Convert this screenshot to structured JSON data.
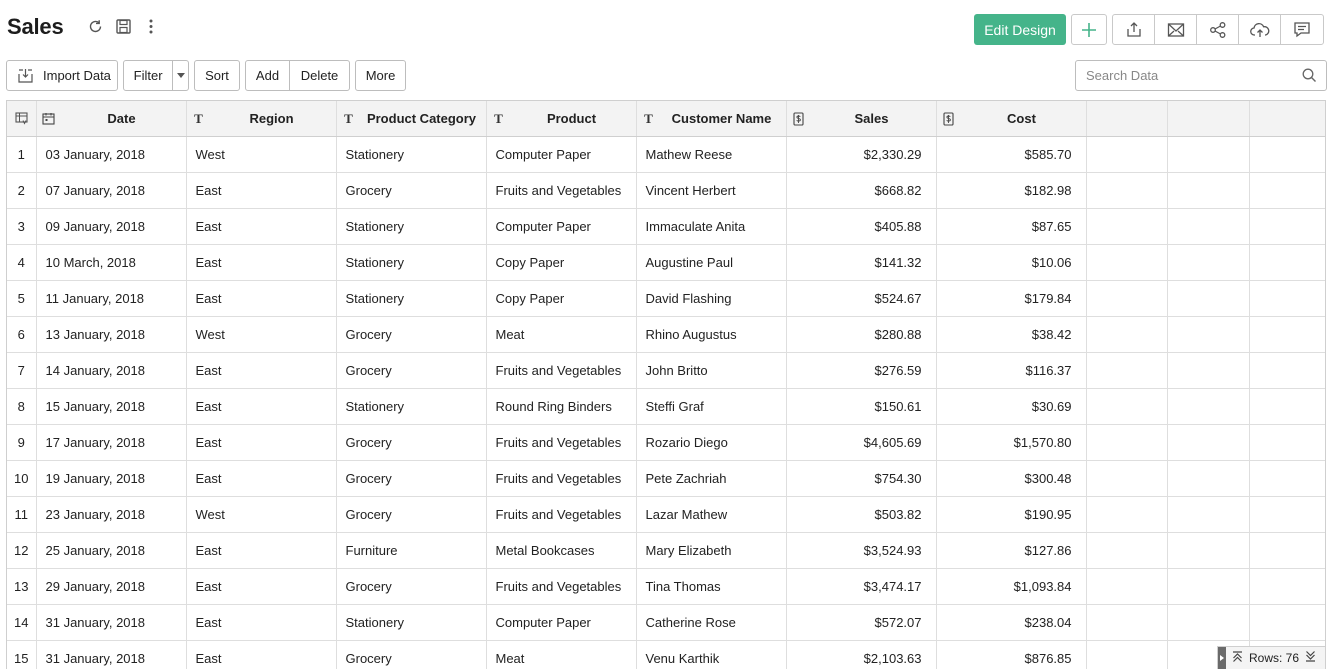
{
  "header": {
    "title": "Sales",
    "edit_design_label": "Edit Design"
  },
  "toolbar": {
    "import_label": "Import Data",
    "filter_label": "Filter",
    "sort_label": "Sort",
    "add_label": "Add",
    "delete_label": "Delete",
    "more_label": "More",
    "search_placeholder": "Search Data"
  },
  "accent_color": "#45b48a",
  "icons": {
    "title": [
      "refresh-icon",
      "save-icon",
      "more-vertical-icon"
    ],
    "actions": [
      "export-icon",
      "email-icon",
      "share-icon",
      "publish-icon",
      "comment-icon"
    ]
  },
  "table": {
    "columns": [
      {
        "label": "Date",
        "type_icon": "calendar-icon"
      },
      {
        "label": "Region",
        "type_icon": "text-type-icon"
      },
      {
        "label": "Product Category",
        "type_icon": "text-type-icon"
      },
      {
        "label": "Product",
        "type_icon": "text-type-icon"
      },
      {
        "label": "Customer Name",
        "type_icon": "text-type-icon"
      },
      {
        "label": "Sales",
        "type_icon": "currency-icon"
      },
      {
        "label": "Cost",
        "type_icon": "currency-icon"
      }
    ],
    "rows": [
      {
        "n": "1",
        "date": "03 January, 2018",
        "region": "West",
        "category": "Stationery",
        "product": "Computer Paper",
        "customer": "Mathew Reese",
        "sales": "$2,330.29",
        "cost": "$585.70"
      },
      {
        "n": "2",
        "date": "07 January, 2018",
        "region": "East",
        "category": "Grocery",
        "product": "Fruits and Vegetables",
        "customer": "Vincent Herbert",
        "sales": "$668.82",
        "cost": "$182.98"
      },
      {
        "n": "3",
        "date": "09 January, 2018",
        "region": "East",
        "category": "Stationery",
        "product": "Computer Paper",
        "customer": "Immaculate Anita",
        "sales": "$405.88",
        "cost": "$87.65"
      },
      {
        "n": "4",
        "date": "10 March, 2018",
        "region": "East",
        "category": "Stationery",
        "product": "Copy Paper",
        "customer": "Augustine Paul",
        "sales": "$141.32",
        "cost": "$10.06"
      },
      {
        "n": "5",
        "date": "11 January, 2018",
        "region": "East",
        "category": "Stationery",
        "product": "Copy Paper",
        "customer": "David Flashing",
        "sales": "$524.67",
        "cost": "$179.84"
      },
      {
        "n": "6",
        "date": "13 January, 2018",
        "region": "West",
        "category": "Grocery",
        "product": "Meat",
        "customer": "Rhino Augustus",
        "sales": "$280.88",
        "cost": "$38.42"
      },
      {
        "n": "7",
        "date": "14 January, 2018",
        "region": "East",
        "category": "Grocery",
        "product": "Fruits and Vegetables",
        "customer": "John Britto",
        "sales": "$276.59",
        "cost": "$116.37"
      },
      {
        "n": "8",
        "date": "15 January, 2018",
        "region": "East",
        "category": "Stationery",
        "product": "Round Ring Binders",
        "customer": "Steffi Graf",
        "sales": "$150.61",
        "cost": "$30.69"
      },
      {
        "n": "9",
        "date": "17 January, 2018",
        "region": "East",
        "category": "Grocery",
        "product": "Fruits and Vegetables",
        "customer": "Rozario Diego",
        "sales": "$4,605.69",
        "cost": "$1,570.80"
      },
      {
        "n": "10",
        "date": "19 January, 2018",
        "region": "East",
        "category": "Grocery",
        "product": "Fruits and Vegetables",
        "customer": "Pete Zachriah",
        "sales": "$754.30",
        "cost": "$300.48"
      },
      {
        "n": "11",
        "date": "23 January, 2018",
        "region": "West",
        "category": "Grocery",
        "product": "Fruits and Vegetables",
        "customer": "Lazar Mathew",
        "sales": "$503.82",
        "cost": "$190.95"
      },
      {
        "n": "12",
        "date": "25 January, 2018",
        "region": "East",
        "category": "Furniture",
        "product": "Metal Bookcases",
        "customer": "Mary Elizabeth",
        "sales": "$3,524.93",
        "cost": "$127.86"
      },
      {
        "n": "13",
        "date": "29 January, 2018",
        "region": "East",
        "category": "Grocery",
        "product": "Fruits and Vegetables",
        "customer": "Tina Thomas",
        "sales": "$3,474.17",
        "cost": "$1,093.84"
      },
      {
        "n": "14",
        "date": "31 January, 2018",
        "region": "East",
        "category": "Stationery",
        "product": "Computer Paper",
        "customer": "Catherine Rose",
        "sales": "$572.07",
        "cost": "$238.04"
      },
      {
        "n": "15",
        "date": "31 January, 2018",
        "region": "East",
        "category": "Grocery",
        "product": "Meat",
        "customer": "Venu Karthik",
        "sales": "$2,103.63",
        "cost": "$876.85"
      }
    ]
  },
  "footer": {
    "rows_label": "Rows: 76"
  }
}
